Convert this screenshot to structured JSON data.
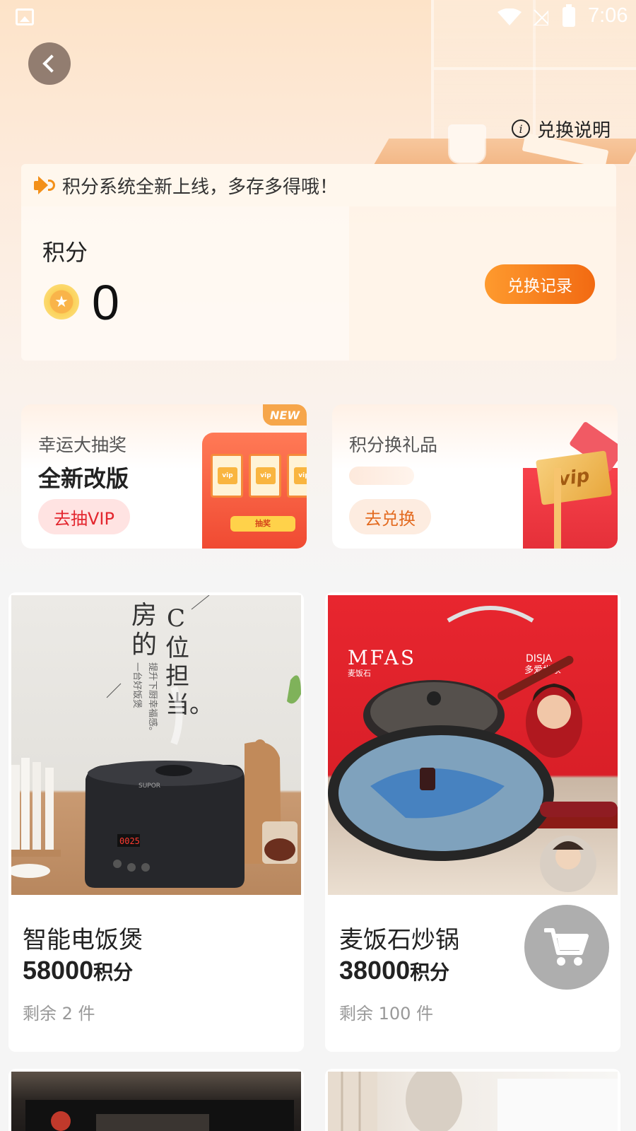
{
  "status_bar": {
    "time": "7:06"
  },
  "header": {
    "explain_label": "兑换说明"
  },
  "points_card": {
    "notice": "积分系统全新上线，多存多得哦！",
    "label": "积分",
    "value": "0",
    "history_button": "兑换记录"
  },
  "promos": {
    "lottery": {
      "subtitle": "幸运大抽奖",
      "title": "全新改版",
      "button": "去抽VIP",
      "badge": "NEW",
      "machine_button": "抽奖",
      "slot_text": "vip"
    },
    "gifts": {
      "subtitle": "积分换礼品",
      "button": "去兑换",
      "card_text": "vip"
    }
  },
  "products": [
    {
      "name": "智能电饭煲",
      "points": "58000",
      "unit": "积分",
      "stock": "剩余 2 件"
    },
    {
      "name": "麦饭石炒锅",
      "points": "38000",
      "unit": "积分",
      "stock": "剩余 100 件"
    }
  ],
  "product_images": {
    "ricecooker": {
      "text1": "房",
      "text2": "的",
      "text3": "C",
      "text4": "位",
      "text5": "担",
      "text6": "当。",
      "side1": "一台好饭煲",
      "side2": "提升下厨幸福感。",
      "display": "0025",
      "brand": "SUPOR"
    },
    "wok": {
      "brand": "MFAS",
      "brand_sub": "麦饭石",
      "brand2": "DISJA",
      "brand2_sub": "多爱世家"
    }
  },
  "colors": {
    "accent_orange": "#f26a12",
    "lottery_red": "#e3262e",
    "exchange_orange": "#e36a1f"
  },
  "icons": {
    "back": "chevron-left-icon",
    "info": "info-icon",
    "notice": "speaker-icon",
    "coin": "coin-icon",
    "cart": "cart-icon"
  }
}
